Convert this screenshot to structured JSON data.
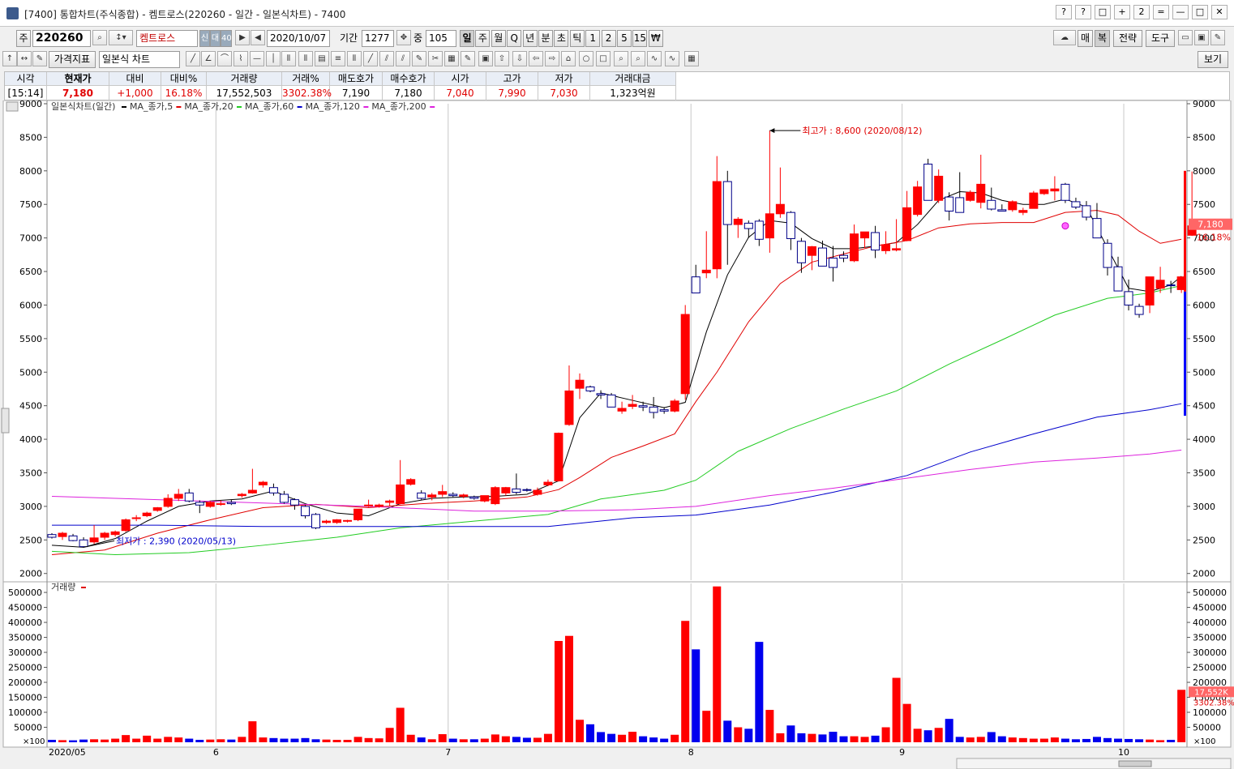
{
  "window": {
    "title": "[7400] 통합차트(주식종합) - 켐트로스(220260 - 일간 - 일본식차트) - 7400",
    "buttons": [
      "?",
      "?",
      "□",
      "+",
      "2",
      "=",
      "—",
      "□",
      "✕"
    ]
  },
  "toolbar1": {
    "market_label": "주",
    "code": "220260",
    "name": "켐트로스",
    "credit_badge": "신",
    "margin_badge": "대",
    "margin_value": "40",
    "date": "2020/10/07",
    "period_label": "기간",
    "period_value": "1277",
    "middle_label": "중",
    "middle_value": "105",
    "period_tabs": [
      "일",
      "주",
      "월",
      "Q",
      "년",
      "분",
      "초",
      "틱",
      "1",
      "2",
      "5",
      "15",
      "₩"
    ],
    "active_tab": "일",
    "right_buttons": [
      "매",
      "복",
      "전략",
      "도구"
    ]
  },
  "toolbar2": {
    "indicator_button": "가격지표",
    "chart_type": "일본식 차트",
    "view_button": "보기"
  },
  "quote_table": {
    "headers": [
      "시각",
      "현재가",
      "대비",
      "대비%",
      "거래량",
      "거래%",
      "매도호가",
      "매수호가",
      "시가",
      "고가",
      "저가",
      "거래대금"
    ],
    "values": [
      "[15:14]",
      "7,180",
      "+1,000",
      "16.18%",
      "17,552,503",
      "3302.38%",
      "7,190",
      "7,180",
      "7,040",
      "7,990",
      "7,030",
      "1,323억원"
    ]
  },
  "chart_data": {
    "type": "candlestick",
    "price_panel_label": "일본식차트(일간)",
    "legend": [
      {
        "name": "MA_종가,5",
        "color": "#000000"
      },
      {
        "name": "MA_종가,20",
        "color": "#e00000"
      },
      {
        "name": "MA_종가,60",
        "color": "#22cc22"
      },
      {
        "name": "MA_종가,120",
        "color": "#0000cc"
      },
      {
        "name": "MA_종가,200",
        "color": "#dd22dd"
      }
    ],
    "volume_panel_label": "거래량",
    "price_ylim": [
      1900,
      9000
    ],
    "price_ticks": [
      2000,
      2500,
      3000,
      3500,
      4000,
      4500,
      5000,
      5500,
      6000,
      6500,
      7000,
      7500,
      8000,
      8500,
      9000
    ],
    "volume_ylim": [
      0,
      530000
    ],
    "volume_ticks": [
      50000,
      100000,
      150000,
      200000,
      250000,
      300000,
      350000,
      400000,
      450000,
      500000
    ],
    "volume_unit": "×100",
    "x_labels": [
      {
        "index": 0,
        "text": "2020/05"
      },
      {
        "index": 16,
        "text": "6"
      },
      {
        "index": 38,
        "text": "7"
      },
      {
        "index": 61,
        "text": "8"
      },
      {
        "index": 81,
        "text": "9"
      },
      {
        "index": 102,
        "text": "10"
      }
    ],
    "high_annotation": {
      "text": "최고가 : 8,600 (2020/08/12)",
      "index": 68,
      "value": 8600
    },
    "low_annotation": {
      "text": "최저가 : 2,390 (2020/05/13)",
      "index": 3,
      "value": 2390
    },
    "last_price_label": "7,180",
    "last_change_label": "16.18%",
    "last_volume_label": "17,552K",
    "last_volume_pct": "3302.38%",
    "candles": [
      [
        2580,
        2600,
        2520,
        2540
      ],
      [
        2550,
        2620,
        2500,
        2600
      ],
      [
        2560,
        2590,
        2480,
        2490
      ],
      [
        2500,
        2540,
        2390,
        2400
      ],
      [
        2470,
        2720,
        2440,
        2530
      ],
      [
        2540,
        2620,
        2500,
        2600
      ],
      [
        2580,
        2640,
        2550,
        2620
      ],
      [
        2640,
        2820,
        2620,
        2800
      ],
      [
        2820,
        2870,
        2780,
        2830
      ],
      [
        2860,
        2920,
        2840,
        2900
      ],
      [
        2940,
        2990,
        2920,
        2980
      ],
      [
        3000,
        3180,
        2980,
        3120
      ],
      [
        3120,
        3260,
        3080,
        3180
      ],
      [
        3200,
        3260,
        3060,
        3080
      ],
      [
        3060,
        3090,
        2900,
        3020
      ],
      [
        3000,
        3080,
        2980,
        3060
      ],
      [
        3040,
        3090,
        3010,
        3040
      ],
      [
        3060,
        3100,
        3020,
        3040
      ],
      [
        3160,
        3200,
        3130,
        3180
      ],
      [
        3200,
        3560,
        3190,
        3240
      ],
      [
        3320,
        3380,
        3280,
        3360
      ],
      [
        3280,
        3340,
        3160,
        3200
      ],
      [
        3180,
        3230,
        3040,
        3060
      ],
      [
        3100,
        3120,
        2950,
        3020
      ],
      [
        3000,
        3020,
        2820,
        2860
      ],
      [
        2880,
        2900,
        2660,
        2680
      ],
      [
        2760,
        2800,
        2740,
        2780
      ],
      [
        2760,
        2810,
        2740,
        2800
      ],
      [
        2780,
        2800,
        2760,
        2790
      ],
      [
        2800,
        2960,
        2780,
        2960
      ],
      [
        3010,
        3100,
        2990,
        3020
      ],
      [
        3000,
        3040,
        2980,
        3020
      ],
      [
        3060,
        3100,
        3000,
        3080
      ],
      [
        3040,
        3690,
        3030,
        3320
      ],
      [
        3330,
        3420,
        3310,
        3400
      ],
      [
        3200,
        3240,
        3100,
        3120
      ],
      [
        3140,
        3200,
        3090,
        3170
      ],
      [
        3180,
        3320,
        3140,
        3220
      ],
      [
        3180,
        3210,
        3140,
        3160
      ],
      [
        3150,
        3190,
        3120,
        3170
      ],
      [
        3140,
        3160,
        3100,
        3120
      ],
      [
        3080,
        3160,
        3060,
        3160
      ],
      [
        3040,
        3300,
        3020,
        3280
      ],
      [
        3200,
        3290,
        3160,
        3280
      ],
      [
        3260,
        3490,
        3180,
        3210
      ],
      [
        3250,
        3270,
        3220,
        3240
      ],
      [
        3180,
        3280,
        3160,
        3240
      ],
      [
        3320,
        3400,
        3300,
        3360
      ],
      [
        3380,
        4100,
        3370,
        4090
      ],
      [
        4220,
        5100,
        4200,
        4720
      ],
      [
        4760,
        4980,
        4600,
        4880
      ],
      [
        4780,
        4800,
        4700,
        4720
      ],
      [
        4680,
        4730,
        4600,
        4660
      ],
      [
        4660,
        4690,
        4480,
        4480
      ],
      [
        4420,
        4560,
        4380,
        4460
      ],
      [
        4490,
        4660,
        4450,
        4520
      ],
      [
        4500,
        4560,
        4420,
        4480
      ],
      [
        4480,
        4630,
        4310,
        4400
      ],
      [
        4440,
        4480,
        4380,
        4420
      ],
      [
        4420,
        4600,
        4400,
        4570
      ],
      [
        4680,
        6000,
        4590,
        5860
      ],
      [
        6420,
        6600,
        6200,
        6180
      ],
      [
        6480,
        7100,
        6400,
        6520
      ],
      [
        6540,
        8220,
        6400,
        7840
      ],
      [
        7840,
        8000,
        6600,
        7200
      ],
      [
        7200,
        7310,
        7000,
        7280
      ],
      [
        7220,
        7260,
        7000,
        7140
      ],
      [
        7250,
        7280,
        6880,
        6980
      ],
      [
        7000,
        8600,
        6780,
        7360
      ],
      [
        7360,
        8050,
        7300,
        7500
      ],
      [
        7380,
        7400,
        6820,
        6990
      ],
      [
        6950,
        7000,
        6480,
        6630
      ],
      [
        6740,
        6880,
        6520,
        6870
      ],
      [
        6850,
        6960,
        6610,
        6580
      ],
      [
        6700,
        6880,
        6350,
        6560
      ],
      [
        6740,
        6800,
        6640,
        6700
      ],
      [
        6660,
        7200,
        6640,
        7060
      ],
      [
        7000,
        7080,
        6850,
        7090
      ],
      [
        7080,
        7180,
        6700,
        6820
      ],
      [
        6810,
        7100,
        6760,
        6900
      ],
      [
        6820,
        7280,
        6800,
        6840
      ],
      [
        6960,
        7700,
        6950,
        7450
      ],
      [
        7350,
        7850,
        7320,
        7760
      ],
      [
        8100,
        8180,
        7700,
        7560
      ],
      [
        7560,
        8020,
        7520,
        7920
      ],
      [
        7610,
        7680,
        7260,
        7400
      ],
      [
        7600,
        7980,
        7380,
        7380
      ],
      [
        7560,
        7710,
        7540,
        7680
      ],
      [
        7530,
        8240,
        7440,
        7800
      ],
      [
        7560,
        7750,
        7410,
        7430
      ],
      [
        7420,
        7500,
        7400,
        7400
      ],
      [
        7420,
        7560,
        7390,
        7540
      ],
      [
        7380,
        7450,
        7340,
        7410
      ],
      [
        7440,
        7700,
        7500,
        7670
      ],
      [
        7660,
        7720,
        7640,
        7720
      ],
      [
        7700,
        7920,
        7560,
        7730
      ],
      [
        7800,
        7820,
        7520,
        7560
      ],
      [
        7540,
        7600,
        7430,
        7460
      ],
      [
        7480,
        7550,
        7260,
        7310
      ],
      [
        7290,
        7520,
        7230,
        7000
      ],
      [
        6920,
        6980,
        6440,
        6560
      ],
      [
        6570,
        6720,
        6330,
        6210
      ],
      [
        6200,
        6380,
        5920,
        6000
      ],
      [
        5980,
        6020,
        5810,
        5860
      ],
      [
        6000,
        6130,
        5880,
        6420
      ],
      [
        6250,
        6570,
        6180,
        6370
      ],
      [
        6300,
        6360,
        6180,
        6290
      ],
      [
        6230,
        6420,
        6180,
        6420
      ],
      [
        7040,
        7990,
        7030,
        7180
      ]
    ],
    "ma": {
      "ma5": [
        [
          0,
          2420
        ],
        [
          3,
          2390
        ],
        [
          6,
          2520
        ],
        [
          9,
          2780
        ],
        [
          12,
          3000
        ],
        [
          15,
          3080
        ],
        [
          18,
          3110
        ],
        [
          21,
          3230
        ],
        [
          24,
          3040
        ],
        [
          27,
          2900
        ],
        [
          30,
          2860
        ],
        [
          33,
          3040
        ],
        [
          36,
          3120
        ],
        [
          39,
          3140
        ],
        [
          42,
          3150
        ],
        [
          45,
          3180
        ],
        [
          48,
          3380
        ],
        [
          50,
          4320
        ],
        [
          52,
          4690
        ],
        [
          55,
          4580
        ],
        [
          58,
          4470
        ],
        [
          60,
          4550
        ],
        [
          62,
          5600
        ],
        [
          64,
          6450
        ],
        [
          66,
          7010
        ],
        [
          68,
          7260
        ],
        [
          70,
          7220
        ],
        [
          72,
          6990
        ],
        [
          74,
          6840
        ],
        [
          76,
          6840
        ],
        [
          78,
          6880
        ],
        [
          80,
          6930
        ],
        [
          82,
          7200
        ],
        [
          84,
          7560
        ],
        [
          86,
          7690
        ],
        [
          88,
          7670
        ],
        [
          90,
          7560
        ],
        [
          92,
          7500
        ],
        [
          94,
          7500
        ],
        [
          96,
          7580
        ],
        [
          98,
          7460
        ],
        [
          100,
          6850
        ],
        [
          102,
          6250
        ],
        [
          104,
          6200
        ],
        [
          106,
          6300
        ],
        [
          107,
          6430
        ]
      ],
      "ma20": [
        [
          0,
          2280
        ],
        [
          5,
          2350
        ],
        [
          10,
          2600
        ],
        [
          15,
          2800
        ],
        [
          20,
          2980
        ],
        [
          25,
          3030
        ],
        [
          30,
          2980
        ],
        [
          35,
          3040
        ],
        [
          40,
          3080
        ],
        [
          45,
          3140
        ],
        [
          48,
          3250
        ],
        [
          50,
          3430
        ],
        [
          53,
          3730
        ],
        [
          56,
          3900
        ],
        [
          59,
          4080
        ],
        [
          61,
          4560
        ],
        [
          63,
          5000
        ],
        [
          66,
          5750
        ],
        [
          69,
          6320
        ],
        [
          72,
          6640
        ],
        [
          75,
          6760
        ],
        [
          78,
          6880
        ],
        [
          81,
          6960
        ],
        [
          84,
          7150
        ],
        [
          87,
          7210
        ],
        [
          90,
          7230
        ],
        [
          93,
          7230
        ],
        [
          96,
          7380
        ],
        [
          99,
          7410
        ],
        [
          101,
          7340
        ],
        [
          103,
          7100
        ],
        [
          105,
          6920
        ],
        [
          107,
          6980
        ]
      ],
      "ma60": [
        [
          0,
          2330
        ],
        [
          6,
          2280
        ],
        [
          13,
          2310
        ],
        [
          20,
          2420
        ],
        [
          27,
          2540
        ],
        [
          33,
          2680
        ],
        [
          40,
          2780
        ],
        [
          47,
          2880
        ],
        [
          52,
          3110
        ],
        [
          58,
          3240
        ],
        [
          61,
          3390
        ],
        [
          65,
          3820
        ],
        [
          70,
          4160
        ],
        [
          75,
          4450
        ],
        [
          80,
          4720
        ],
        [
          85,
          5120
        ],
        [
          90,
          5480
        ],
        [
          95,
          5850
        ],
        [
          100,
          6100
        ],
        [
          104,
          6180
        ],
        [
          107,
          6290
        ]
      ],
      "ma120": [
        [
          0,
          2720
        ],
        [
          10,
          2720
        ],
        [
          20,
          2700
        ],
        [
          30,
          2700
        ],
        [
          40,
          2700
        ],
        [
          47,
          2700
        ],
        [
          55,
          2830
        ],
        [
          61,
          2870
        ],
        [
          68,
          3020
        ],
        [
          74,
          3210
        ],
        [
          81,
          3460
        ],
        [
          87,
          3810
        ],
        [
          93,
          4080
        ],
        [
          99,
          4330
        ],
        [
          104,
          4440
        ],
        [
          107,
          4530
        ]
      ],
      "ma200": [
        [
          0,
          3150
        ],
        [
          10,
          3100
        ],
        [
          20,
          3050
        ],
        [
          30,
          3000
        ],
        [
          40,
          2930
        ],
        [
          47,
          2930
        ],
        [
          55,
          2950
        ],
        [
          61,
          3000
        ],
        [
          68,
          3160
        ],
        [
          74,
          3270
        ],
        [
          81,
          3420
        ],
        [
          87,
          3550
        ],
        [
          93,
          3660
        ],
        [
          99,
          3720
        ],
        [
          104,
          3780
        ],
        [
          107,
          3840
        ]
      ]
    },
    "volumes": [
      8000,
      7000,
      6500,
      9000,
      10000,
      9000,
      12000,
      24000,
      12000,
      22000,
      12000,
      18000,
      16000,
      12000,
      8000,
      9000,
      10000,
      9000,
      18000,
      70000,
      16000,
      14000,
      12000,
      12000,
      14000,
      10000,
      9000,
      8000,
      8000,
      18000,
      14000,
      13000,
      48000,
      115000,
      25000,
      16000,
      10000,
      27000,
      12000,
      10000,
      10000,
      12000,
      26000,
      20000,
      18000,
      15000,
      15000,
      28000,
      338000,
      355000,
      75000,
      60000,
      34000,
      28000,
      25000,
      35000,
      20000,
      16000,
      12000,
      25000,
      405000,
      310000,
      105000,
      520000,
      72000,
      50000,
      45000,
      335000,
      108000,
      30000,
      56000,
      30000,
      28000,
      26000,
      35000,
      20000,
      20000,
      18000,
      22000,
      50000,
      215000,
      128000,
      45000,
      40000,
      48000,
      78000,
      18000,
      16000,
      18000,
      34000,
      20000,
      16000,
      14000,
      12000,
      12000,
      16000,
      12000,
      10000,
      11000,
      18000,
      14000,
      12000,
      11000,
      10000,
      9000,
      7000,
      8000,
      175000
    ]
  }
}
